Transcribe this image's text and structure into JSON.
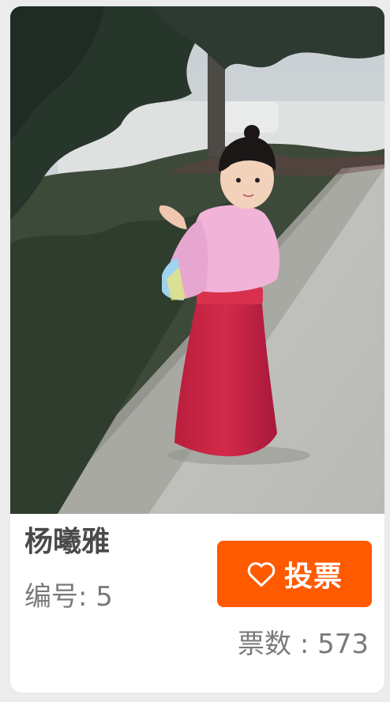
{
  "contestant": {
    "name": "杨曦雅",
    "number_label": "编号: 5",
    "vote_button_label": "投票",
    "vote_count_label": "票数 : 573"
  },
  "colors": {
    "accent": "#ff5a00",
    "text_primary": "#4a4a4a",
    "text_secondary": "#7a7a7a",
    "background": "#ececec",
    "card": "#ffffff"
  },
  "icons": {
    "vote": "heart-outline-icon"
  },
  "photo": {
    "subject": "child-in-hanfu-photo"
  }
}
